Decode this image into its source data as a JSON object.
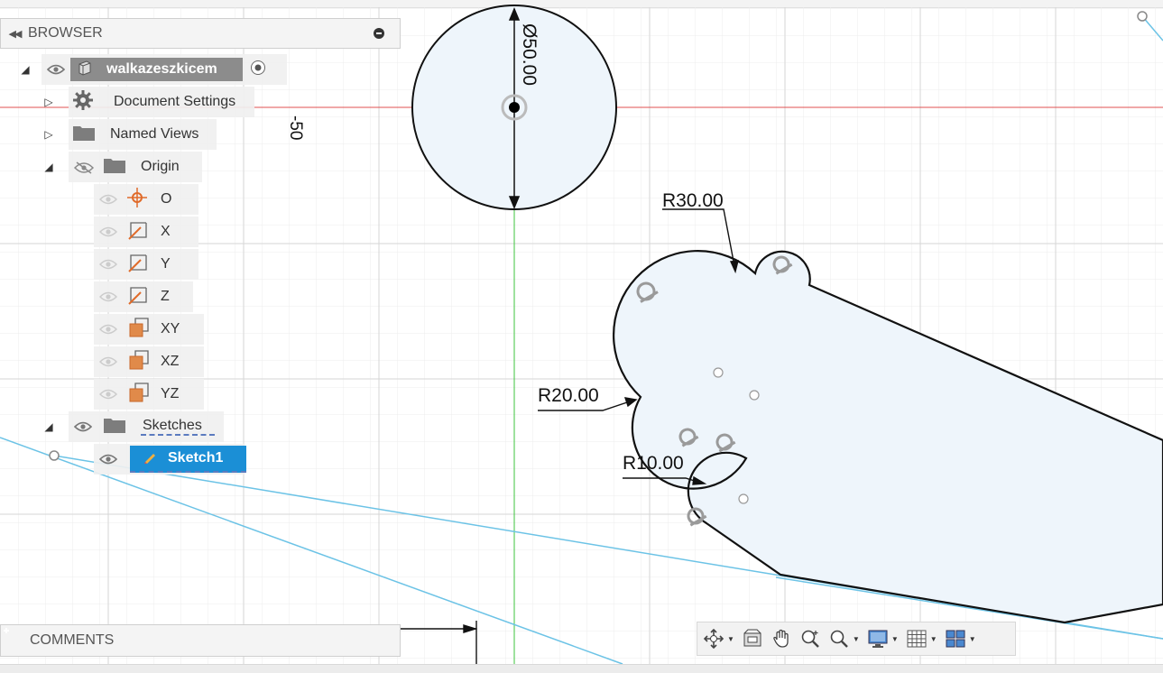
{
  "browser": {
    "title": "BROWSER",
    "component_name": "walkazeszkicem",
    "items": {
      "document_settings": "Document Settings",
      "named_views": "Named Views",
      "origin": "Origin",
      "o": "O",
      "x": "X",
      "y": "Y",
      "z": "Z",
      "xy": "XY",
      "xz": "XZ",
      "yz": "YZ",
      "sketches": "Sketches",
      "sketch1": "Sketch1"
    }
  },
  "comments": {
    "title": "COMMENTS"
  },
  "canvas": {
    "dims": {
      "diameter": "Ø50.00",
      "r30": "R30.00",
      "r20": "R20.00",
      "r10": "R10.00",
      "axis_label": "-50"
    }
  },
  "icons": {
    "collapse": "double-chevron-left-icon",
    "minus": "minus-circle-icon",
    "plus": "plus-circle-icon",
    "eye": "eye-icon",
    "eye_hidden": "eye-slash-icon",
    "gear": "gear-icon",
    "folder": "folder-icon",
    "component": "component-box-icon",
    "radio": "radio-button-icon",
    "origin_point": "origin-point-icon",
    "axis": "axis-icon",
    "plane": "plane-icon",
    "sketch": "sketch-icon",
    "orbit": "orbit-icon",
    "look_at": "look-at-icon",
    "pan": "pan-hand-icon",
    "zoom": "zoom-icon",
    "zoom_window": "zoom-window-icon",
    "display": "display-settings-icon",
    "grid": "grid-icon",
    "viewports": "viewports-icon"
  },
  "colors": {
    "selection": "#1b8fd6",
    "sketch_line": "#6cc3e6",
    "red_axis": "#e05050",
    "green_axis": "#3ec43e",
    "origin_orange": "#e06b2a"
  }
}
